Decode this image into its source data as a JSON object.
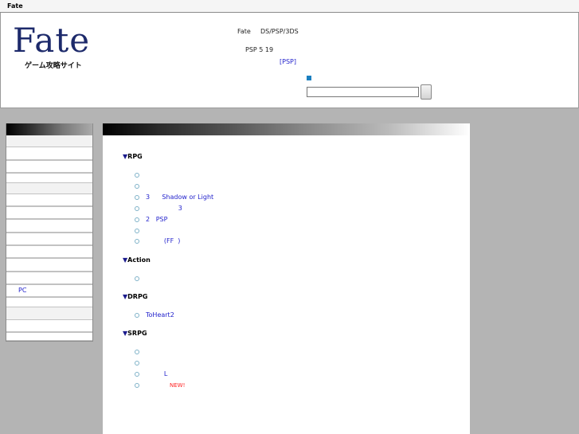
{
  "topbar": {
    "title": "Fate"
  },
  "header": {
    "logo": "Fate",
    "logo_sub": "ゲーム攻略サイト",
    "line1_a": "Fate",
    "line1_b": "DS/PSP/3DS",
    "line2": "PSP 5 19",
    "line3": "[PSP]"
  },
  "sidebar": {
    "items": [
      "",
      "",
      "",
      "",
      "",
      "",
      "",
      "",
      "",
      "",
      "",
      "PC",
      "",
      "",
      "",
      ""
    ]
  },
  "content": {
    "categories": [
      {
        "name": "RPG",
        "items": [
          {
            "text": ""
          },
          {
            "text": ""
          },
          {
            "text": "3      Shadow or Light"
          },
          {
            "text": "                3"
          },
          {
            "text": "2   PSP"
          },
          {
            "text": ""
          },
          {
            "text": "         (FF  )"
          }
        ]
      },
      {
        "name": "Action",
        "items": [
          {
            "text": ""
          }
        ]
      },
      {
        "name": "DRPG",
        "items": [
          {
            "text": "ToHeart2"
          }
        ]
      },
      {
        "name": "SRPG",
        "items": [
          {
            "text": ""
          },
          {
            "text": ""
          },
          {
            "text": "         L"
          },
          {
            "text": "",
            "badge": "NEW!"
          }
        ]
      }
    ]
  }
}
